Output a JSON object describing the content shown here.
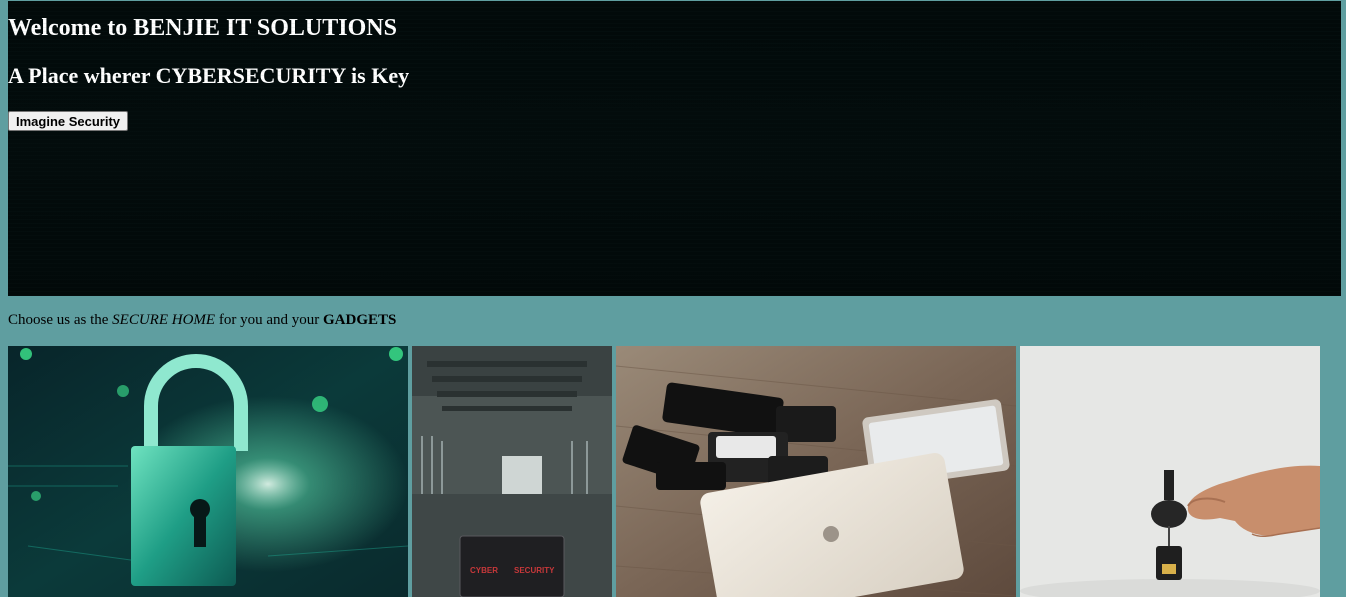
{
  "hero": {
    "title": "Welcome to BENJIE IT SOLUTIONS",
    "subtitle": "A Place wherer CYBERSECURITY is Key",
    "button_label": "Imagine Security"
  },
  "tagline": {
    "prefix": "Choose us as the ",
    "emphasis": "SECURE HOME",
    "middle": " for you and your ",
    "strong": "GADGETS"
  },
  "gallery": {
    "images": [
      {
        "name": "padlock-image"
      },
      {
        "name": "cyber-security-laptop-image",
        "overlay_left": "CYBER",
        "overlay_right": "SECURITY"
      },
      {
        "name": "devices-image"
      },
      {
        "name": "usb-key-image"
      }
    ]
  }
}
